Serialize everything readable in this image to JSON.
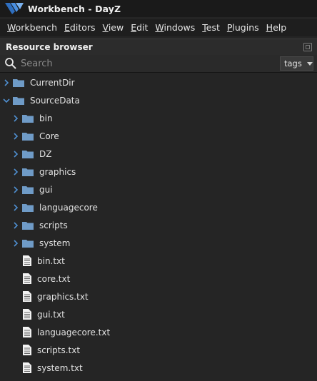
{
  "window": {
    "title": "Workbench - DayZ"
  },
  "menu": {
    "items": [
      {
        "first": "W",
        "rest": "orkbench"
      },
      {
        "first": "E",
        "rest": "ditors"
      },
      {
        "first": "V",
        "rest": "iew"
      },
      {
        "first": "E",
        "rest": "dit"
      },
      {
        "first": "W",
        "rest": "indows"
      },
      {
        "first": "T",
        "rest": "est"
      },
      {
        "first": "P",
        "rest": "lugins"
      },
      {
        "first": "H",
        "rest": "elp"
      }
    ]
  },
  "panel": {
    "title": "Resource browser"
  },
  "search": {
    "placeholder": "Search",
    "value": "",
    "tags_label": "tags"
  },
  "tree": {
    "nodes": [
      {
        "label": "CurrentDir",
        "type": "folder",
        "expanded": false
      },
      {
        "label": "SourceData",
        "type": "folder",
        "expanded": true
      },
      {
        "label": "bin",
        "type": "folder",
        "expanded": false
      },
      {
        "label": "Core",
        "type": "folder",
        "expanded": false
      },
      {
        "label": "DZ",
        "type": "folder",
        "expanded": false
      },
      {
        "label": "graphics",
        "type": "folder",
        "expanded": false
      },
      {
        "label": "gui",
        "type": "folder",
        "expanded": false
      },
      {
        "label": "languagecore",
        "type": "folder",
        "expanded": false
      },
      {
        "label": "scripts",
        "type": "folder",
        "expanded": false
      },
      {
        "label": "system",
        "type": "folder",
        "expanded": false
      },
      {
        "label": "bin.txt",
        "type": "file"
      },
      {
        "label": "core.txt",
        "type": "file"
      },
      {
        "label": "graphics.txt",
        "type": "file"
      },
      {
        "label": "gui.txt",
        "type": "file"
      },
      {
        "label": "languagecore.txt",
        "type": "file"
      },
      {
        "label": "scripts.txt",
        "type": "file"
      },
      {
        "label": "system.txt",
        "type": "file"
      }
    ]
  },
  "colors": {
    "folder": "#6f9bc7",
    "chevron": "#4f8fd0",
    "background": "#252525"
  }
}
